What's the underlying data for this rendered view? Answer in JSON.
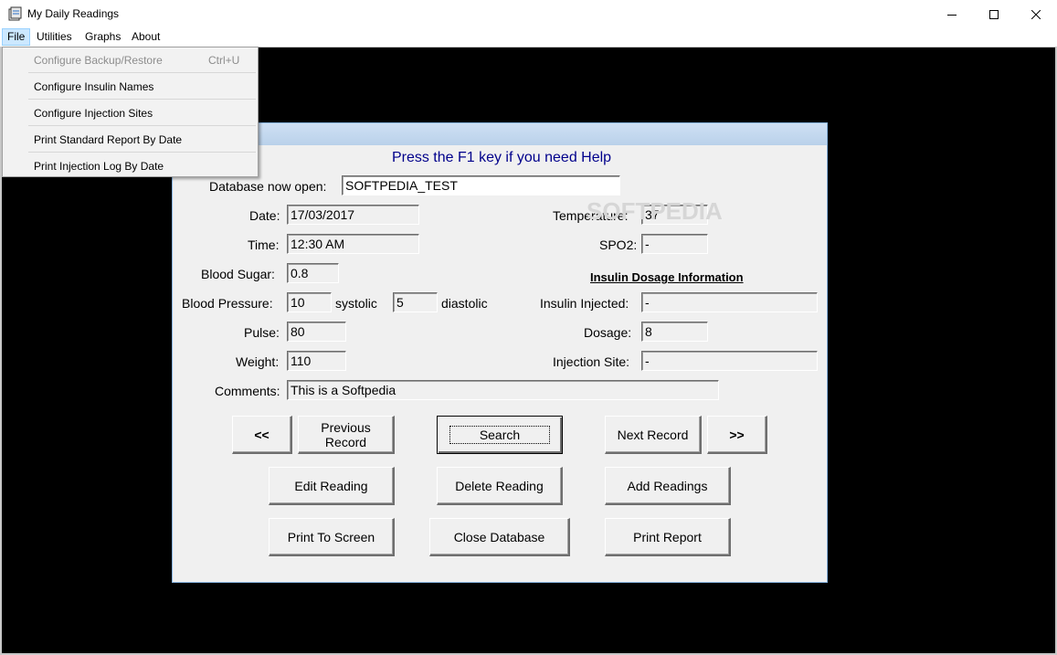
{
  "window": {
    "title": "My Daily Readings",
    "controls": [
      "minimize",
      "maximize",
      "close"
    ]
  },
  "menubar": {
    "items": [
      {
        "label": "File",
        "active": true
      },
      {
        "label": "Utilities"
      },
      {
        "label": "Graphs"
      },
      {
        "label": "About"
      }
    ]
  },
  "file_menu": {
    "items": [
      {
        "label": "Configure Backup/Restore",
        "shortcut": "Ctrl+U",
        "enabled": false
      },
      {
        "label": "Configure Insulin Names",
        "enabled": true
      },
      {
        "label": "Configure Injection Sites",
        "enabled": true
      },
      {
        "label": "Print Standard Report By Date",
        "enabled": true
      },
      {
        "label": "Print Injection Log By Date",
        "enabled": true
      }
    ]
  },
  "form": {
    "help_text": "Press the F1 key if you need Help",
    "database_label": "Database now open:",
    "database_value": "SOFTPEDIA_TEST",
    "date_label": "Date:",
    "date_value": "17/03/2017",
    "time_label": "Time:",
    "time_value": "12:30 AM",
    "blood_sugar_label": "Blood Sugar:",
    "blood_sugar_value": "0.8",
    "blood_pressure_label": "Blood Pressure:",
    "systolic_value": "10",
    "systolic_label": "systolic",
    "diastolic_value": "5",
    "diastolic_label": "diastolic",
    "pulse_label": "Pulse:",
    "pulse_value": "80",
    "weight_label": "Weight:",
    "weight_value": "110",
    "comments_label": "Comments:",
    "comments_value": "This is a Softpedia",
    "temperature_label": "Temperature:",
    "temperature_value": "37",
    "spo2_label": "SPO2:",
    "spo2_value": "-",
    "insulin_heading": "Insulin Dosage Information",
    "insulin_injected_label": "Insulin Injected:",
    "insulin_injected_value": "-",
    "dosage_label": "Dosage:",
    "dosage_value": "8",
    "injection_site_label": "Injection Site:",
    "injection_site_value": "-"
  },
  "buttons": {
    "first": "<<",
    "previous_line1": "Previous",
    "previous_line2": "Record",
    "search": "Search",
    "next": "Next Record",
    "last": ">>",
    "edit": "Edit Reading",
    "delete": "Delete Reading",
    "add": "Add Readings",
    "print_screen": "Print To Screen",
    "close_db": "Close Database",
    "print_report": "Print Report"
  },
  "watermark": "SOFTPEDIA",
  "colors": {
    "help_text": "#00008b",
    "client_background": "#000000",
    "menu_highlight": "#cce8ff",
    "form_background": "#f0f0f0"
  }
}
